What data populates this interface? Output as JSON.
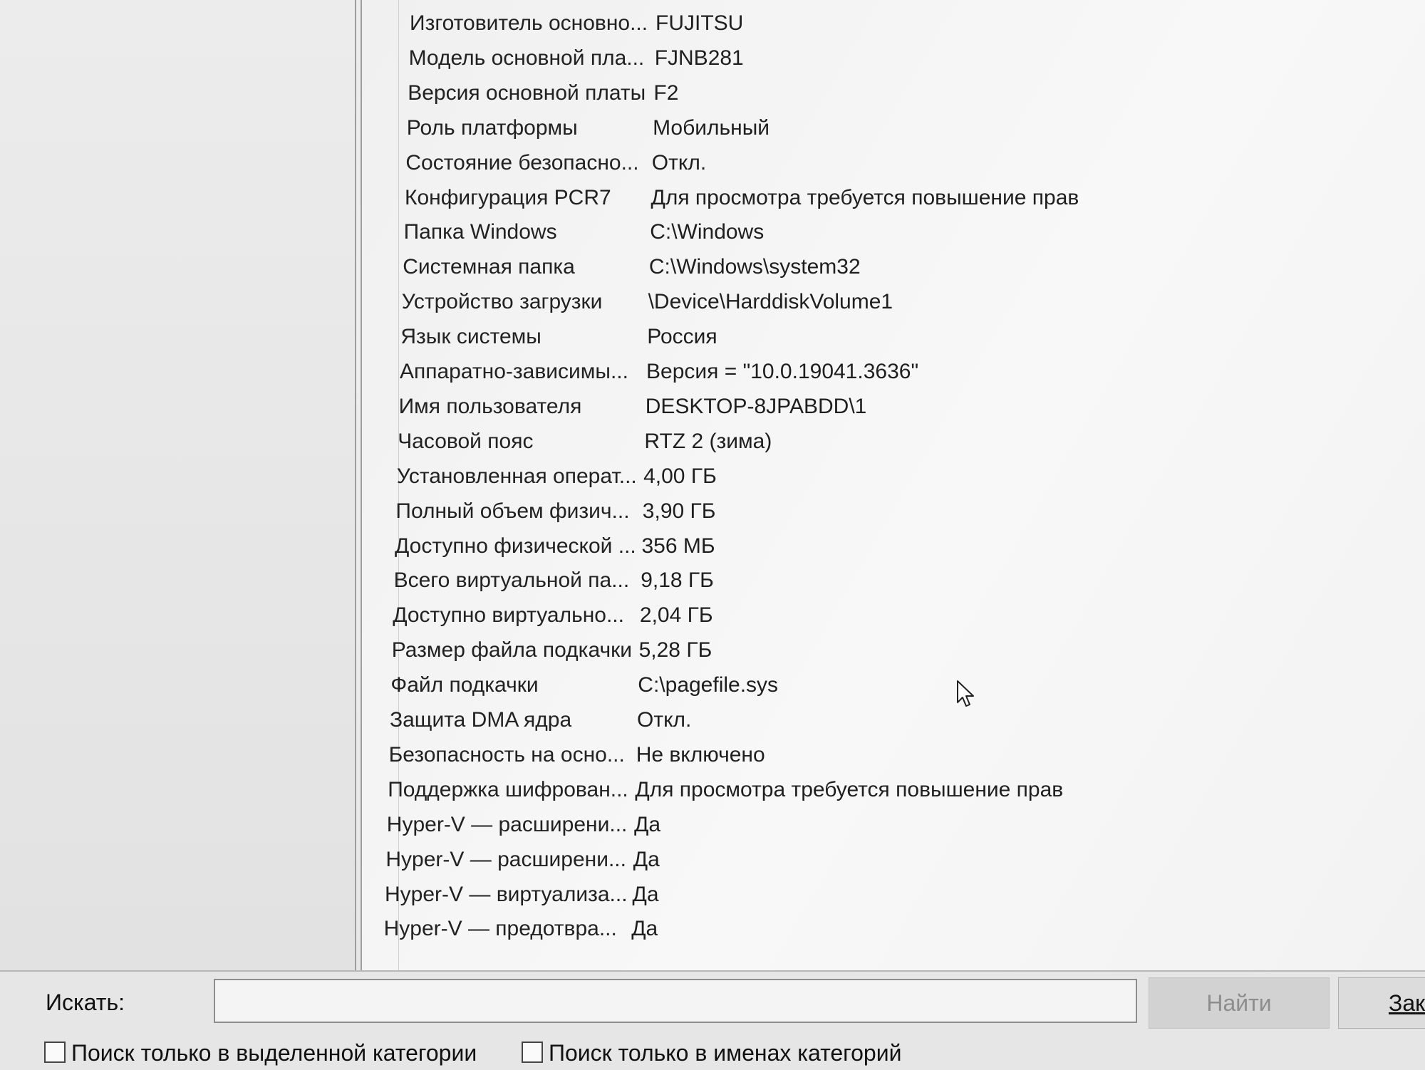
{
  "system_summary": {
    "rows": [
      {
        "item": "Изготовитель основно...",
        "value": "FUJITSU"
      },
      {
        "item": "Модель основной пла...",
        "value": "FJNB281"
      },
      {
        "item": "Версия основной платы",
        "value": "F2"
      },
      {
        "item": "Роль платформы",
        "value": "Мобильный"
      },
      {
        "item": "Состояние безопасно...",
        "value": "Откл."
      },
      {
        "item": "Конфигурация PCR7",
        "value": "Для просмотра требуется повышение прав"
      },
      {
        "item": "Папка Windows",
        "value": "C:\\Windows"
      },
      {
        "item": "Системная папка",
        "value": "C:\\Windows\\system32"
      },
      {
        "item": "Устройство загрузки",
        "value": "\\Device\\HarddiskVolume1"
      },
      {
        "item": "Язык системы",
        "value": "Россия"
      },
      {
        "item": "Аппаратно-зависимы...",
        "value": "Версия = \"10.0.19041.3636\""
      },
      {
        "item": "Имя пользователя",
        "value": "DESKTOP-8JPABDD\\1"
      },
      {
        "item": "Часовой пояс",
        "value": "RTZ 2 (зима)"
      },
      {
        "item": "Установленная операт...",
        "value": "4,00 ГБ"
      },
      {
        "item": "Полный объем физич...",
        "value": "3,90 ГБ"
      },
      {
        "item": "Доступно физической ...",
        "value": "356 МБ"
      },
      {
        "item": "Всего виртуальной па...",
        "value": "9,18 ГБ"
      },
      {
        "item": "Доступно виртуально...",
        "value": "2,04 ГБ"
      },
      {
        "item": "Размер файла подкачки",
        "value": "5,28 ГБ"
      },
      {
        "item": "Файл подкачки",
        "value": "C:\\pagefile.sys"
      },
      {
        "item": "Защита DMA ядра",
        "value": "Откл."
      },
      {
        "item": "Безопасность на осно...",
        "value": "Не включено"
      },
      {
        "item": "Поддержка шифрован...",
        "value": "Для просмотра требуется повышение прав"
      },
      {
        "item": "Hyper-V — расширени...",
        "value": "Да"
      },
      {
        "item": "Hyper-V — расширени...",
        "value": "Да"
      },
      {
        "item": "Hyper-V — виртуализа...",
        "value": "Да"
      },
      {
        "item": "Hyper-V — предотвра...",
        "value": "Да"
      }
    ]
  },
  "search": {
    "label": "Искать:",
    "value": "",
    "find_button": "Найти",
    "close_button": "Зак"
  },
  "options": {
    "selected_category_only": "Поиск только в выделенной категории",
    "category_names_only": "Поиск только в именах категорий"
  }
}
